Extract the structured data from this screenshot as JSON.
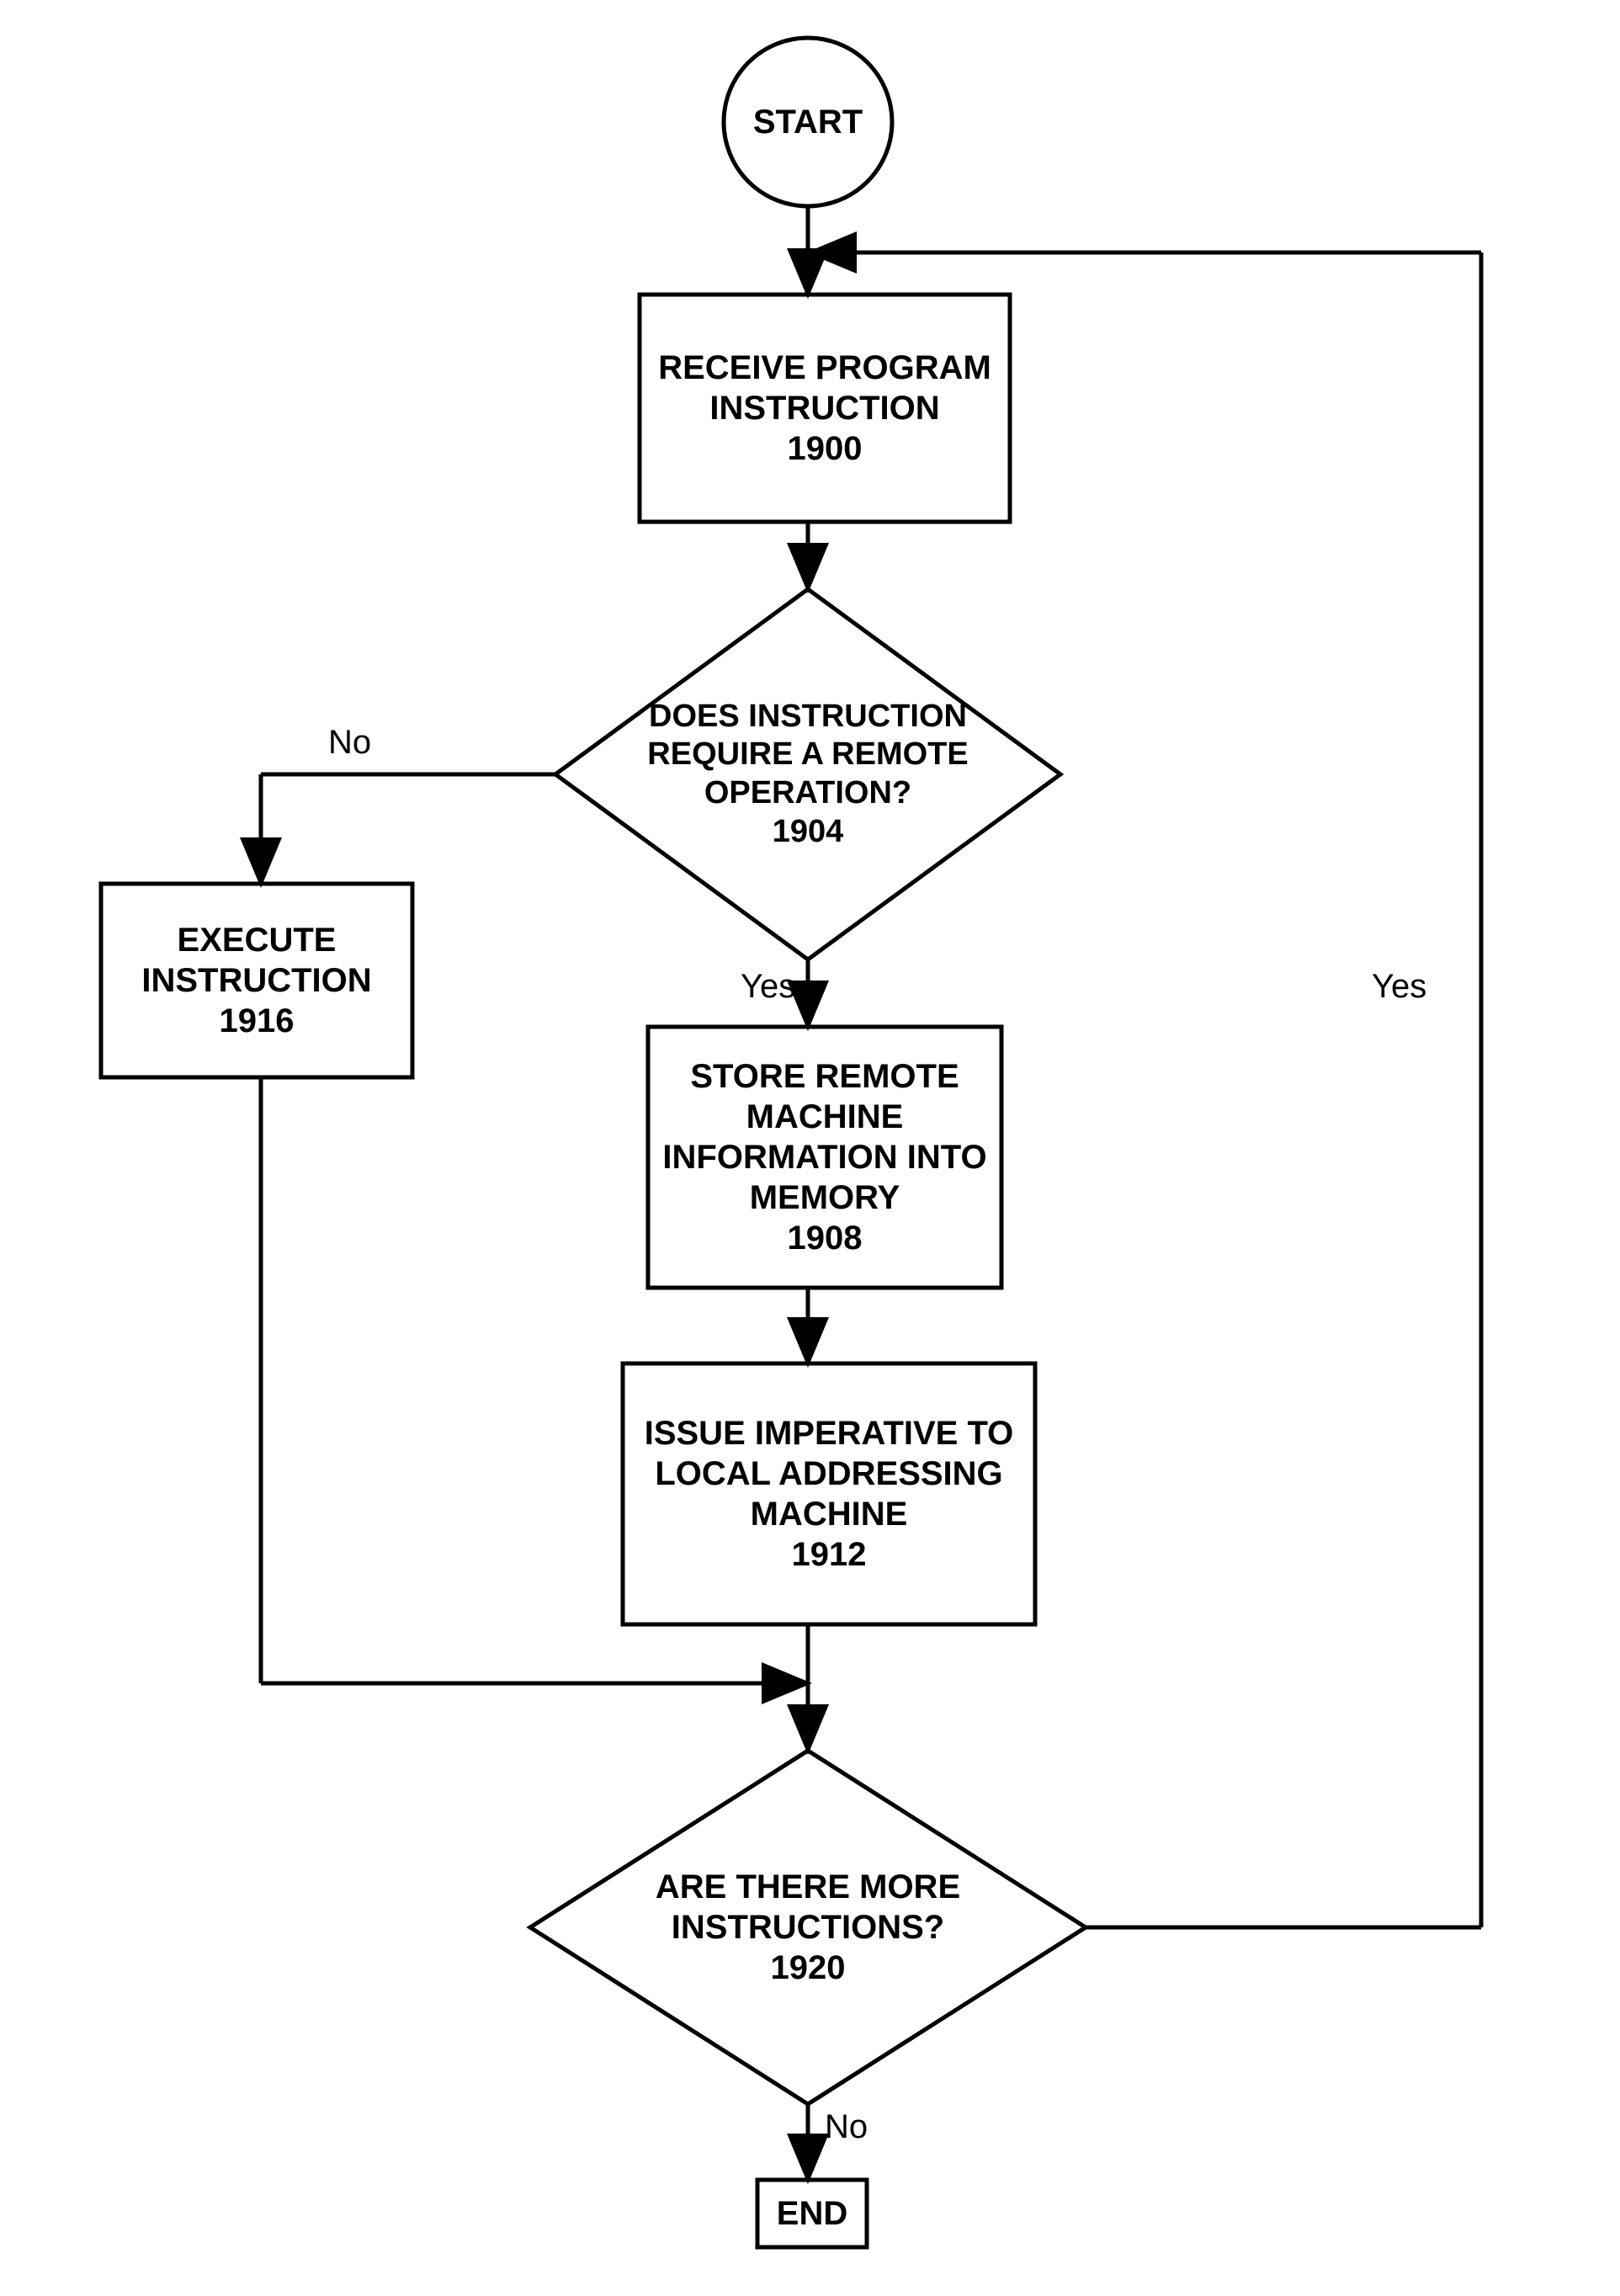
{
  "nodes": {
    "start": {
      "label": "START"
    },
    "receive": {
      "label": "RECEIVE PROGRAM INSTRUCTION",
      "ref": "1900"
    },
    "decision_remote": {
      "label": "DOES INSTRUCTION REQUIRE A REMOTE OPERATION?",
      "ref": "1904"
    },
    "execute": {
      "label": "EXECUTE INSTRUCTION",
      "ref": "1916"
    },
    "store": {
      "label": "STORE REMOTE MACHINE INFORMATION INTO MEMORY",
      "ref": "1908"
    },
    "issue": {
      "label": "ISSUE IMPERATIVE TO LOCAL ADDRESSING MACHINE",
      "ref": "1912"
    },
    "decision_more": {
      "label": "ARE THERE MORE INSTRUCTIONS?",
      "ref": "1920"
    },
    "end": {
      "label": "END"
    }
  },
  "edges": {
    "no1": "No",
    "yes1": "Yes",
    "no2": "No",
    "yes2": "Yes"
  }
}
